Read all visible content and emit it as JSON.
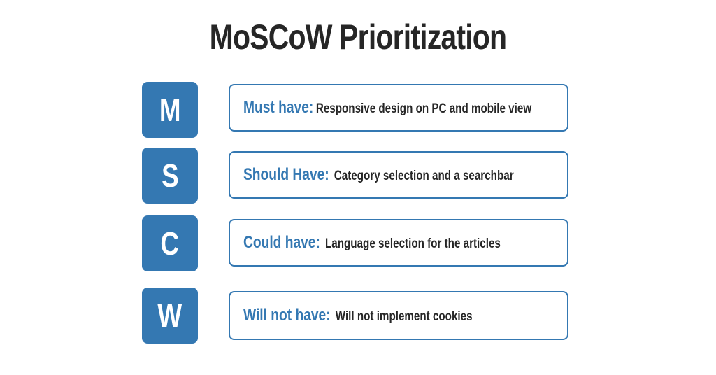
{
  "title": "MoSCoW Prioritization",
  "rows": [
    {
      "letter": "M",
      "label": "Must have:",
      "text": "Responsive design on PC and mobile view"
    },
    {
      "letter": "S",
      "label": "Should Have:",
      "text": "Category selection and a searchbar"
    },
    {
      "letter": "C",
      "label": "Could have:",
      "text": "Language selection for the articles"
    },
    {
      "letter": "W",
      "label": "Will not have:",
      "text": "Will not implement cookies"
    }
  ],
  "colors": {
    "accent": "#3478b2",
    "text": "#262626"
  }
}
